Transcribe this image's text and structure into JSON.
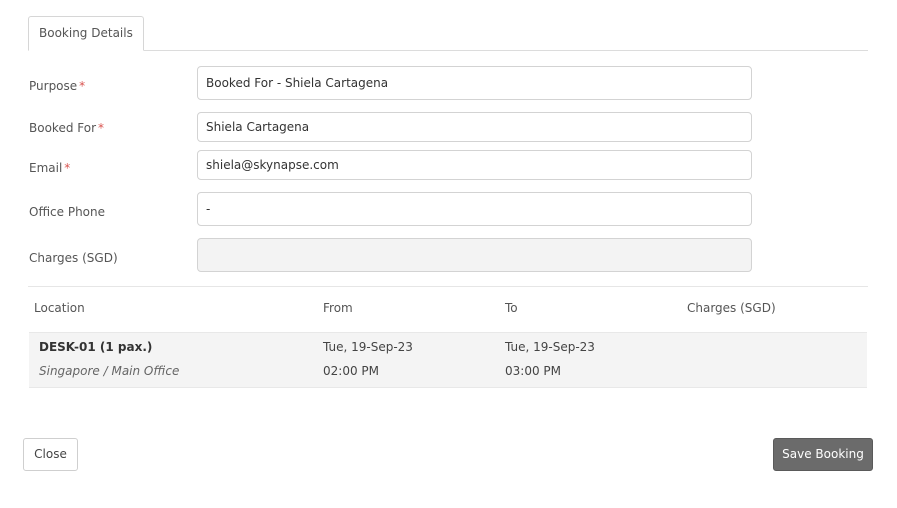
{
  "tabs": [
    {
      "label": "Booking Details",
      "active": true
    }
  ],
  "form": {
    "required_marker": "*",
    "purpose": {
      "label": "Purpose",
      "value": "Booked For - Shiela Cartagena"
    },
    "booked_for": {
      "label": "Booked For",
      "value": "Shiela Cartagena"
    },
    "email": {
      "label": "Email",
      "value": "shiela@skynapse.com"
    },
    "office_phone": {
      "label": "Office Phone",
      "value": "-"
    },
    "charges": {
      "label": "Charges (SGD)",
      "value": ""
    }
  },
  "table": {
    "headers": {
      "location": "Location",
      "from": "From",
      "to": "To",
      "charges": "Charges (SGD)"
    },
    "rows": [
      {
        "location_name": "DESK-01 (1 pax.)",
        "location_sub": "Singapore / Main Office",
        "from_date": "Tue, 19-Sep-23",
        "from_time": "02:00 PM",
        "to_date": "Tue, 19-Sep-23",
        "to_time": "03:00 PM",
        "charges": ""
      }
    ]
  },
  "buttons": {
    "close": "Close",
    "save": "Save Booking"
  },
  "colors": {
    "required": "#d9534f",
    "primary_button": "#6b6b6b",
    "row_background": "#f4f4f4",
    "disabled_input": "#f3f3f3"
  }
}
